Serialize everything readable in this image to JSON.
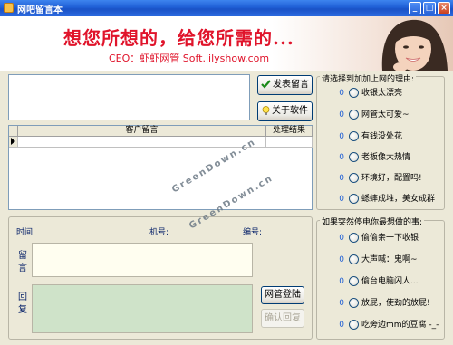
{
  "window": {
    "title": "网吧留言本"
  },
  "banner": {
    "slogan": "想您所想的，给您所需的...",
    "subline": "CEO：虾虾网管  Soft.lilyshow.com"
  },
  "buttons": {
    "publish": "发表留言",
    "about": "关于软件",
    "admin_login": "网管登陆",
    "confirm_reply": "确认回复"
  },
  "grid": {
    "headers": [
      "客户留言",
      "处理结果"
    ]
  },
  "detail": {
    "time_label": "时间:",
    "machine_label": "机号:",
    "number_label": "编号:",
    "message_label": "留\n言",
    "reply_label": "回\n复"
  },
  "reasons": {
    "title": "请选择到加加上网的理由:",
    "items": [
      {
        "count": "0",
        "label": "收银太漂亮"
      },
      {
        "count": "0",
        "label": "网管太可爱~"
      },
      {
        "count": "0",
        "label": "有钱没处花"
      },
      {
        "count": "0",
        "label": "老板像大热情"
      },
      {
        "count": "0",
        "label": "环境好，配置吗!"
      },
      {
        "count": "0",
        "label": "蟋蟀成堆，美女成群"
      }
    ]
  },
  "poweroff": {
    "title": "如果突然停电你最想做的事:",
    "items": [
      {
        "count": "0",
        "label": "偷偷亲一下收银"
      },
      {
        "count": "0",
        "label": "大声喊：鬼啊~"
      },
      {
        "count": "0",
        "label": "偷台电脑闪人..."
      },
      {
        "count": "0",
        "label": "放屁，使劲的放屁!"
      },
      {
        "count": "0",
        "label": "吃旁边mm的豆腐 -_-"
      }
    ]
  },
  "watermarks": [
    "GreenDown.cn",
    "GreenDown.cn"
  ],
  "colors": {
    "titlebar": "#1f5fd6",
    "slogan": "#e0142b",
    "reply_box": "#cfe3c9",
    "message_box": "#fffef0",
    "count": "#1f5fd6"
  }
}
